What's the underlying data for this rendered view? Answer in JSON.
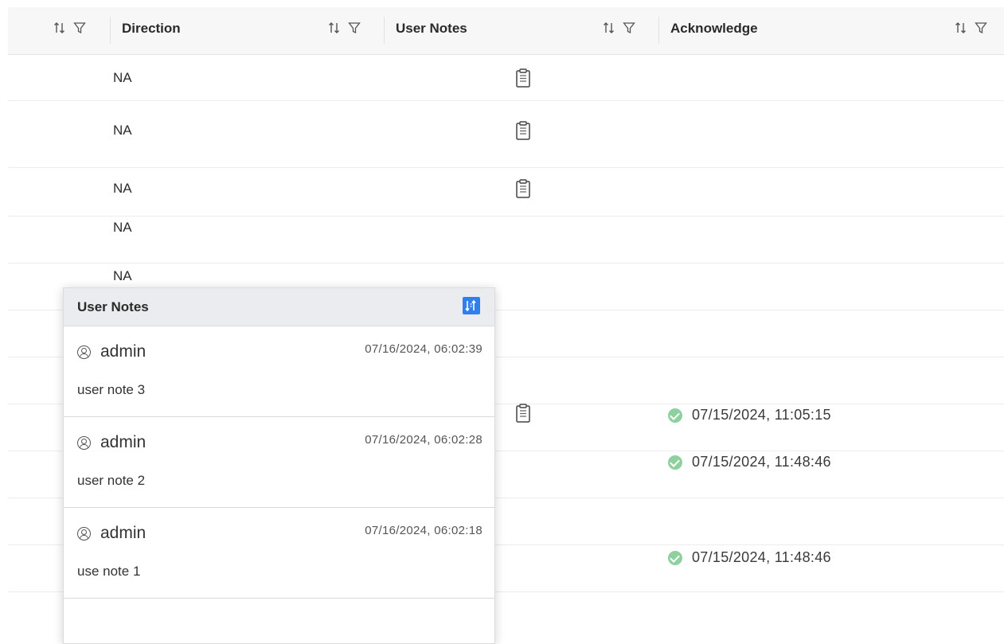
{
  "table": {
    "columns": [
      {
        "label": "Direction"
      },
      {
        "label": "User Notes"
      },
      {
        "label": "Acknowledge"
      }
    ],
    "rows": [
      {
        "direction": "NA",
        "has_note": true,
        "ack": ""
      },
      {
        "direction": "NA",
        "has_note": true,
        "ack": ""
      },
      {
        "direction": "NA",
        "has_note": true,
        "ack": ""
      },
      {
        "direction": "NA",
        "has_note": false,
        "ack": ""
      },
      {
        "direction": "NA",
        "has_note": false,
        "ack": ""
      },
      {
        "direction": "",
        "has_note": false,
        "ack": ""
      },
      {
        "direction": "",
        "has_note": false,
        "ack": ""
      },
      {
        "direction": "",
        "has_note": true,
        "ack": "07/15/2024, 11:05:15"
      },
      {
        "direction": "",
        "has_note": false,
        "ack": "07/15/2024, 11:48:46"
      },
      {
        "direction": "",
        "has_note": false,
        "ack": ""
      },
      {
        "direction": "",
        "has_note": false,
        "ack": "07/15/2024, 11:48:46"
      }
    ]
  },
  "popup": {
    "title": "User Notes",
    "notes": [
      {
        "user": "admin",
        "time": "07/16/2024, 06:02:39",
        "text": "user note 3"
      },
      {
        "user": "admin",
        "time": "07/16/2024, 06:02:28",
        "text": "user note 2"
      },
      {
        "user": "admin",
        "time": "07/16/2024, 06:02:18",
        "text": "use note 1"
      }
    ]
  },
  "icons": {
    "sort": "sort-icon",
    "filter": "filter-icon",
    "note": "clipboard-icon",
    "check": "check-circle-icon",
    "user": "user-circle-icon",
    "popup_sort": "sort-order-icon"
  },
  "colors": {
    "accent": "#2f80ed",
    "check": "#8fd19e",
    "header_bg": "#f7f7f8"
  }
}
